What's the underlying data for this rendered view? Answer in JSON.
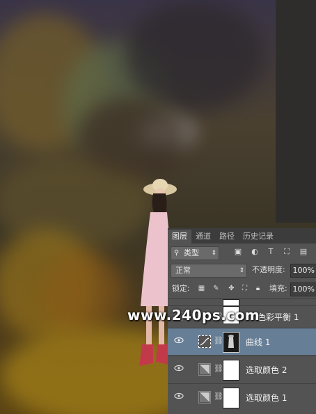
{
  "layers_panel": {
    "tabs": [
      "图层",
      "通道",
      "路径",
      "历史记录"
    ],
    "filter_label": "类型",
    "filter_icons": [
      "image-filter-icon",
      "adjustment-filter-icon",
      "type-filter-icon",
      "shape-filter-icon",
      "smart-object-filter-icon"
    ],
    "blend_mode": "正常",
    "opacity_label": "不透明度:",
    "opacity_value": "100%",
    "lock_label": "锁定:",
    "fill_label": "填充:",
    "fill_value": "100%",
    "layers": [
      {
        "name": "色彩平衡 1",
        "type": "color-balance",
        "visible": false
      },
      {
        "name": "曲线 1",
        "type": "curves",
        "visible": true,
        "selected": true
      },
      {
        "name": "选取颜色 2",
        "type": "selective-color",
        "visible": true
      },
      {
        "name": "选取颜色 1",
        "type": "selective-color",
        "visible": true
      }
    ]
  },
  "watermark": "www.240ps.com",
  "colors": {
    "panel_bg": "#535353",
    "panel_tabbar": "#3c3c3c",
    "selected_layer": "#667e96"
  }
}
